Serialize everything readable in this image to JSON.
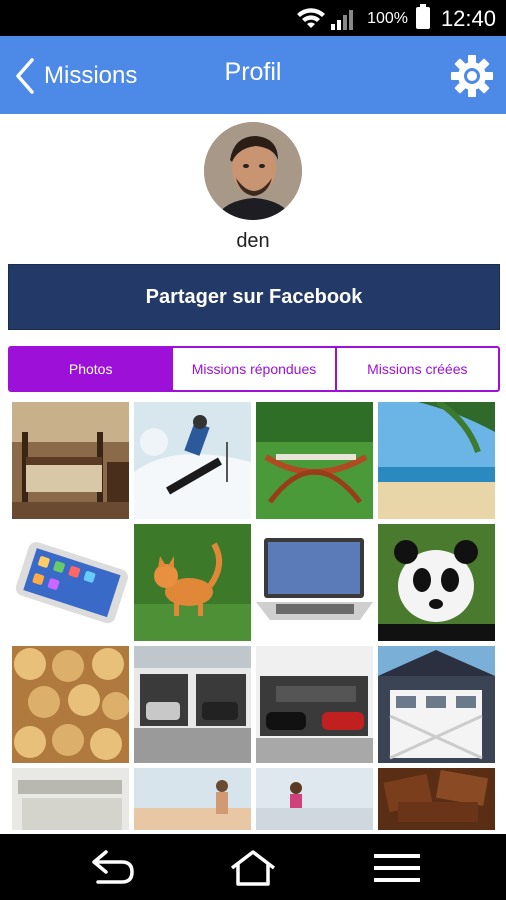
{
  "status_bar": {
    "battery": "100%",
    "time": "12:40"
  },
  "app_bar": {
    "back_label": "Missions",
    "title": "Profil"
  },
  "profile": {
    "username": "den"
  },
  "share_button": {
    "label": "Partager sur Facebook"
  },
  "tabs": [
    {
      "label": "Photos",
      "active": true
    },
    {
      "label": "Missions répondues",
      "active": false
    },
    {
      "label": "Missions créées",
      "active": false
    }
  ],
  "photos": [
    {
      "subject": "bedroom-photo"
    },
    {
      "subject": "snowboarder-photo"
    },
    {
      "subject": "hammock-photo"
    },
    {
      "subject": "beach-photo"
    },
    {
      "subject": "smartphone-photo"
    },
    {
      "subject": "kitten-photo"
    },
    {
      "subject": "laptop-photo"
    },
    {
      "subject": "panda-photo"
    },
    {
      "subject": "cookies-photo"
    },
    {
      "subject": "garage-photo"
    },
    {
      "subject": "garage-cars-photo"
    },
    {
      "subject": "garage-door-photo"
    },
    {
      "subject": "shelf-photo"
    },
    {
      "subject": "runner-photo"
    },
    {
      "subject": "runner-photo-2"
    },
    {
      "subject": "chocolate-photo"
    }
  ],
  "colors": {
    "app_bar": "#4d8ae8",
    "share_button": "#233a68",
    "tab_accent": "#9d10d8"
  }
}
